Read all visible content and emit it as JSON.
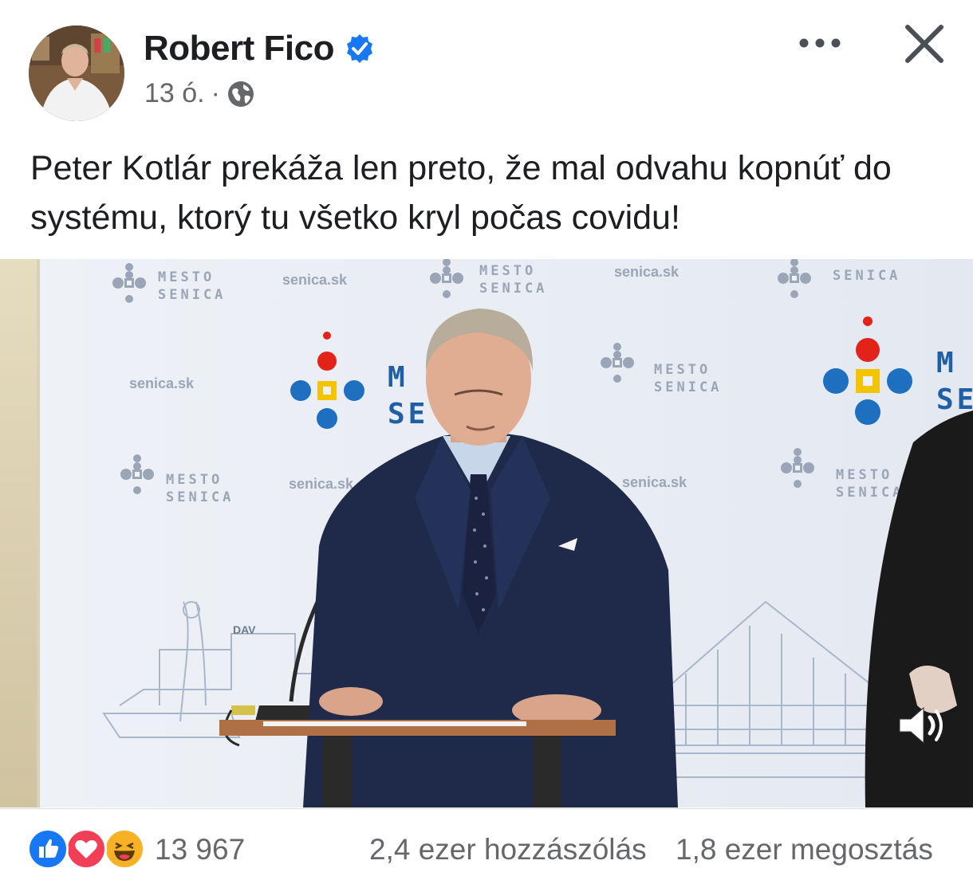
{
  "post": {
    "author": "Robert Fico",
    "verified": true,
    "time": "13 ó.",
    "separator": "·",
    "audience_icon": "globe-icon",
    "text": "Peter Kotlár prekáža len preto, že mal odvahu kopnúť do systému, ktorý tu všetko kryl počas covidu!"
  },
  "video": {
    "backdrop_brand": [
      "MESTO",
      "SENICA"
    ],
    "backdrop_domain": "senica.sk",
    "backdrop_big_letters": [
      "M",
      "SE"
    ],
    "building_sign": "DAV",
    "sound_icon": "speaker-icon"
  },
  "footer": {
    "reactions": [
      "like-icon",
      "love-icon",
      "haha-icon"
    ],
    "reaction_count": "13 967",
    "comments": "2,4 ezer hozzászólás",
    "shares": "1,8 ezer megosztás"
  },
  "colors": {
    "verified_blue": "#1877f2",
    "secondary_text": "#65676b",
    "logo_red": "#e2231a",
    "logo_blue": "#1e6fbf",
    "logo_yellow": "#f5c400",
    "suit_navy": "#1f2a4a"
  }
}
